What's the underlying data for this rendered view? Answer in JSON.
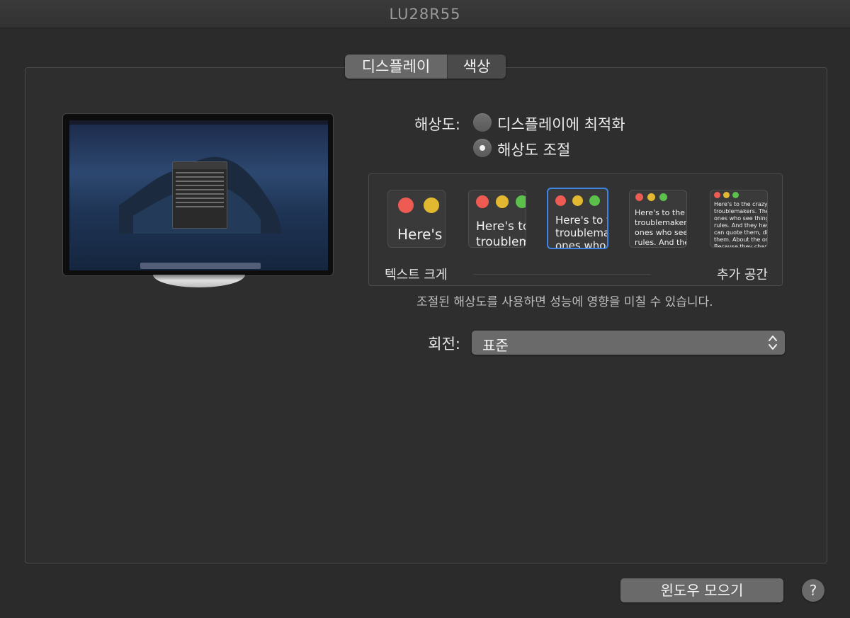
{
  "window": {
    "title": "LU28R55"
  },
  "tabs": [
    {
      "label": "디스플레이",
      "selected": true
    },
    {
      "label": "색상",
      "selected": false
    }
  ],
  "resolution": {
    "label": "해상도:",
    "options": [
      {
        "label": "디스플레이에 최적화",
        "selected": false
      },
      {
        "label": "해상도 조절",
        "selected": true
      }
    ]
  },
  "scaling": {
    "options": [
      {
        "text": "Here's"
      },
      {
        "text": "Here's to\ntroublem"
      },
      {
        "text": "Here's to t\ntroublema\nones who"
      },
      {
        "text": "Here's to the cr\ntroublemakers.\nones who see t\nrules. And they"
      },
      {
        "text": "Here's to the crazy one\ntroublemakers. The rou\nones who see things dif\nrules. And they have no\ncan quote them, disagr\nthem. About the only th\nBecause they change th"
      }
    ],
    "selected_index": 2,
    "left_label": "텍스트 크게",
    "right_label": "추가 공간"
  },
  "note": "조절된 해상도를 사용하면 성능에 영향을 미칠 수 있습니다.",
  "rotation": {
    "label": "회전:",
    "value": "표준"
  },
  "footer": {
    "gather_windows": "윈도우 모으기",
    "help": "?"
  },
  "colors": {
    "accent": "#3f84e5",
    "red": "#ed5b52",
    "yellow": "#e2b830",
    "green": "#5cc14a"
  }
}
